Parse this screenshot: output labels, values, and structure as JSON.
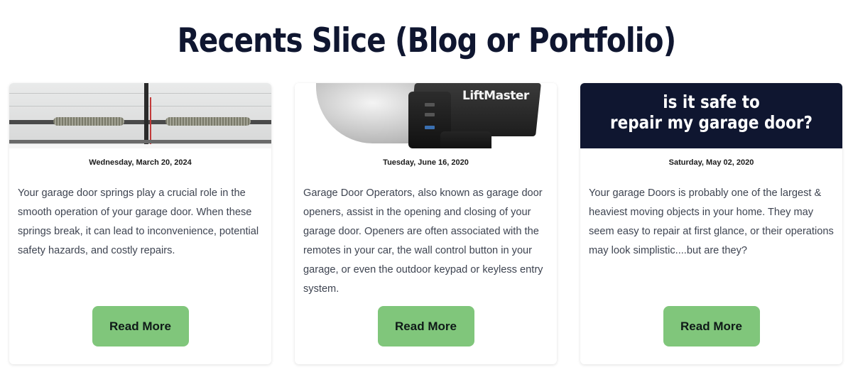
{
  "section": {
    "title": "Recents Slice (Blog or Portfolio)"
  },
  "cards": [
    {
      "date": "Wednesday, March 20, 2024",
      "excerpt": "Your garage door springs play a crucial role in the smooth operation of your garage door. When these springs break, it can lead to inconvenience, potential safety hazards, and costly repairs.",
      "button_label": "Read More"
    },
    {
      "date": "Tuesday, June 16, 2020",
      "excerpt": "Garage Door Operators, also known as garage door openers, assist in the opening and closing of your garage door. Openers are often associated with the remotes in your car, the wall control button in your garage, or even the outdoor keypad or keyless entry system.",
      "button_label": "Read More",
      "image_brand_text": "LiftMaster"
    },
    {
      "date": "Saturday, May 02, 2020",
      "excerpt": "Your garage Doors is probably one of the largest & heaviest moving objects in your home. They may seem easy to repair at first glance, or their operations may look simplistic....but are they?",
      "button_label": "Read More",
      "image_text_line1": "is it safe to",
      "image_text_line2": "repair my garage door?"
    }
  ],
  "colors": {
    "title": "#0f1630",
    "button": "#80c67b",
    "banner_bg": "#0f1630"
  }
}
